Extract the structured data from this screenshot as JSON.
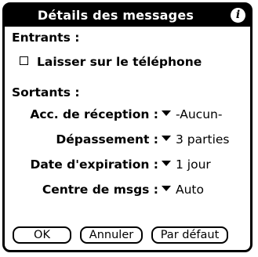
{
  "dialog": {
    "title": "Détails des messages",
    "incoming": {
      "heading": "Entrants :",
      "checkbox_label": "Laisser sur le téléphone",
      "checked": false
    },
    "outgoing": {
      "heading": "Sortants :",
      "fields": [
        {
          "label": "Acc. de réception :",
          "value": "-Aucun-"
        },
        {
          "label": "Dépassement :",
          "value": "3 parties"
        },
        {
          "label": "Date d'expiration :",
          "value": "1 jour"
        },
        {
          "label": "Centre de msgs :",
          "value": "Auto"
        }
      ]
    },
    "buttons": {
      "ok": "OK",
      "cancel": "Annuler",
      "default": "Par défaut"
    }
  }
}
